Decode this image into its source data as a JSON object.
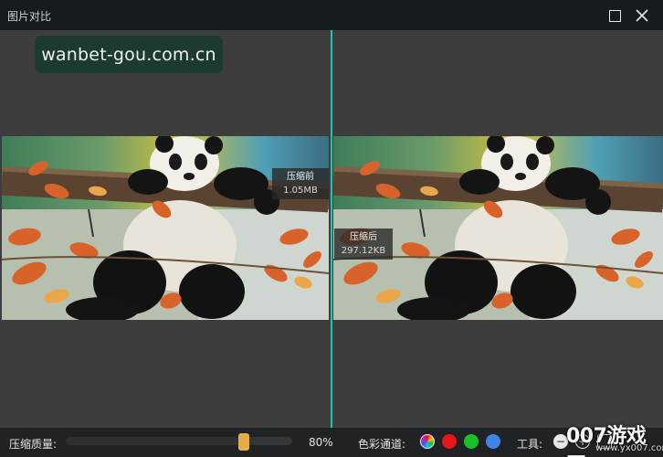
{
  "window": {
    "title": "图片对比",
    "maximize_icon": "maximize-icon",
    "close_icon": "close-icon"
  },
  "watermark": {
    "text": "wanbet-gou.com.cn"
  },
  "left_panel": {
    "badge_title": "压缩前",
    "badge_size": "1.05MB"
  },
  "right_panel": {
    "badge_title": "压缩后",
    "badge_size": "297.12KB"
  },
  "bottom_bar": {
    "quality_label": "压缩质量:",
    "quality_value": "80%",
    "quality_fraction": 0.8,
    "channel_label": "色彩通道:",
    "channels": [
      {
        "name": "all-channels",
        "color": "multicolor"
      },
      {
        "name": "red",
        "color": "#e8151b"
      },
      {
        "name": "green",
        "color": "#16c226"
      },
      {
        "name": "blue",
        "color": "#3d86e8"
      }
    ],
    "tools_label": "工具:",
    "tools": [
      "zoom-out-icon",
      "zoom-in-icon",
      "fit-icon"
    ]
  },
  "site_mark": {
    "text": "007游戏网",
    "url": "www.yx007.com"
  },
  "colors": {
    "divider": "#27c3a8",
    "slider_thumb": "#e6ad45",
    "titlebar": "#161b20",
    "bottombar": "#202326"
  }
}
